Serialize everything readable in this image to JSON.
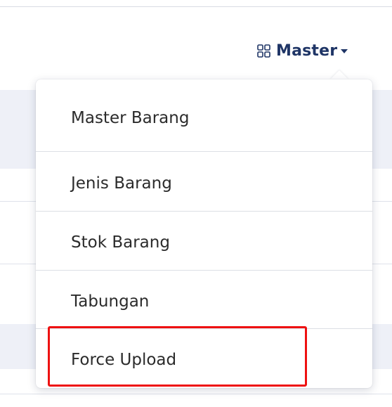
{
  "nav": {
    "master_label": "Master",
    "icon": "grid-icon",
    "caret_icon": "caret-down-icon"
  },
  "dropdown": {
    "items": [
      {
        "label": "Master Barang"
      },
      {
        "label": "Jenis Barang"
      },
      {
        "label": "Stok Barang"
      },
      {
        "label": "Tabungan"
      },
      {
        "label": "Force Upload"
      }
    ]
  },
  "colors": {
    "nav_text": "#1f3566",
    "highlight": "#ee1111",
    "menu_text": "#2b2b2b"
  }
}
